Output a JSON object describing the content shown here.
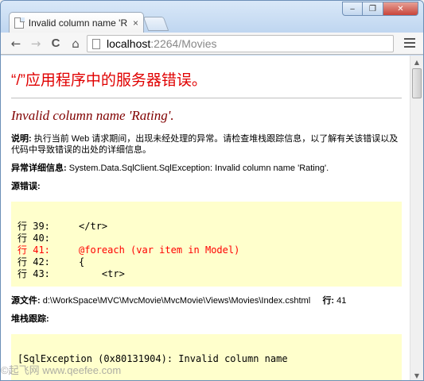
{
  "browser": {
    "tab_title": "Invalid column name 'R",
    "tab_close": "×",
    "window_buttons": {
      "minimize": "‒",
      "maximize": "❐",
      "close": "✕"
    },
    "nav": {
      "back": "←",
      "forward": "→",
      "reload": "C",
      "home": "⌂"
    },
    "address": {
      "host": "localhost",
      "path": ":2264/Movies"
    }
  },
  "page": {
    "header": "“/”应用程序中的服务器错误。",
    "error_title": "Invalid column name 'Rating'.",
    "description_label": "说明:",
    "description_text": "执行当前 Web 请求期间，出现未经处理的异常。请检查堆栈跟踪信息，以了解有关该错误以及代码中导致错误的出处的详细信息。",
    "exception_label": "异常详细信息:",
    "exception_text": "System.Data.SqlClient.SqlException: Invalid column name 'Rating'.",
    "source_error_label": "源错误:",
    "source_lines": [
      {
        "text": "行 39:     </tr>",
        "error": false
      },
      {
        "text": "行 40:",
        "error": false
      },
      {
        "text": "行 41:     @foreach (var item in Model)",
        "error": true
      },
      {
        "text": "行 42:     {",
        "error": false
      },
      {
        "text": "行 43:         <tr>",
        "error": false
      }
    ],
    "source_file_label": "源文件:",
    "source_file_path": "d:\\WorkSpace\\MVC\\MvcMovie\\MvcMovie\\Views\\Movies\\Index.cshtml",
    "line_label": "行:",
    "line_number": "41",
    "stack_trace_label": "堆栈跟踪:",
    "stack_trace_first": "[SqlException (0x80131904): Invalid column name"
  },
  "watermark": "©起飞网 www.qeefee.com"
}
